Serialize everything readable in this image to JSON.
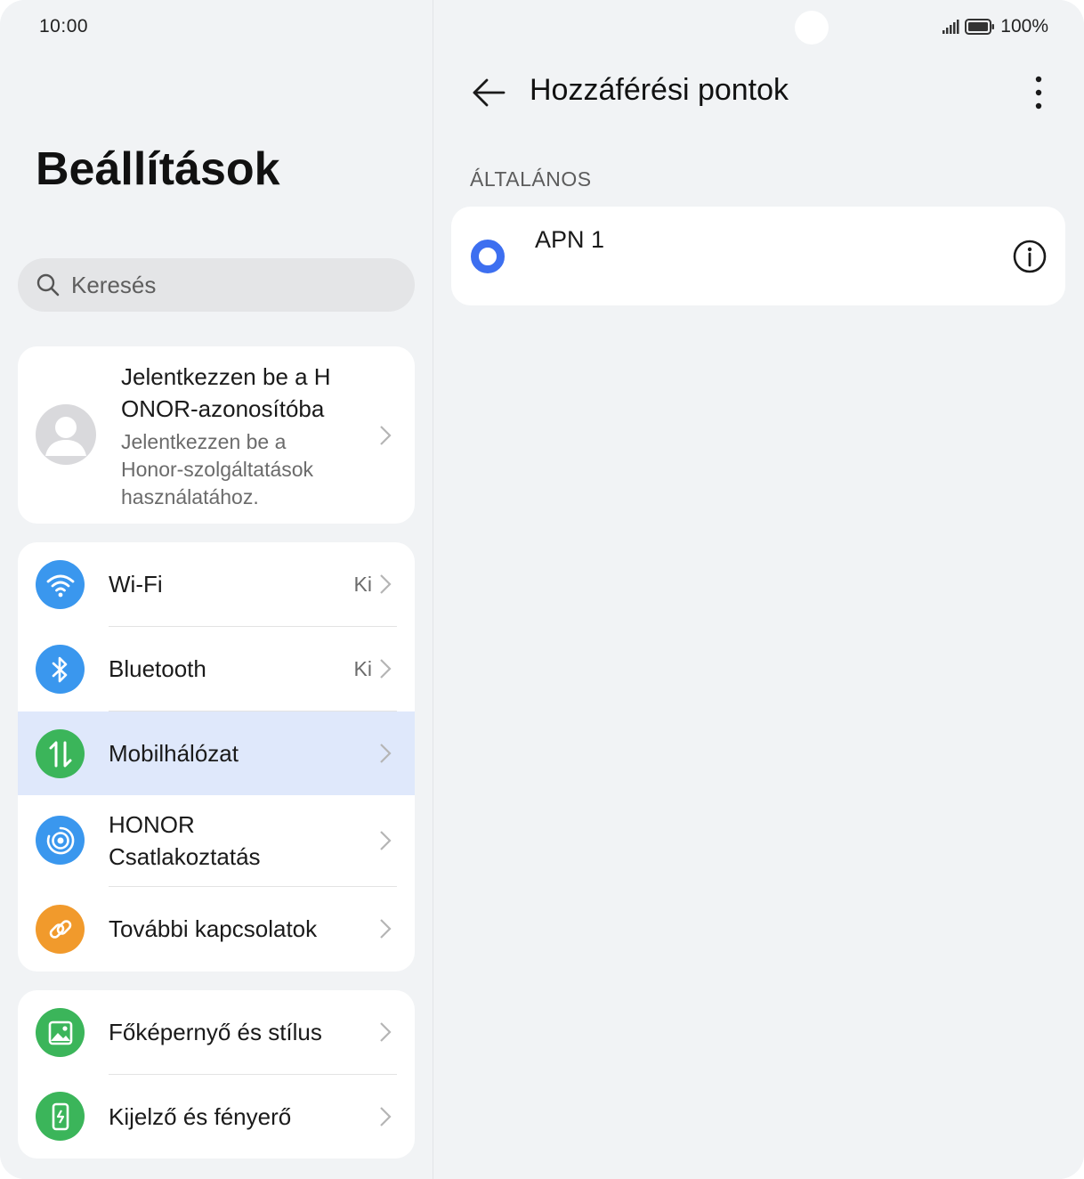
{
  "status_bar": {
    "time": "10:00",
    "battery": "100%",
    "icons": [
      "signal-icon",
      "battery-icon"
    ]
  },
  "settings": {
    "title": "Beállítások",
    "search_placeholder": "Keresés",
    "account": {
      "title": "Jelentkezzen be a HONOR-azonosítóba",
      "title_line1": "Jelentkezzen be a H",
      "title_line2": "ONOR-azonosítóba",
      "subtitle_line1": "Jelentkezzen be a",
      "subtitle_line2": "Honor-szolgáltatások",
      "subtitle_line3": "használatához."
    },
    "network_items": [
      {
        "label": "Wi-Fi",
        "value": "Ki",
        "icon": "wifi-icon",
        "color": "#3a97ee"
      },
      {
        "label": "Bluetooth",
        "value": "Ki",
        "icon": "bluetooth-icon",
        "color": "#3a97ee"
      },
      {
        "label": "Mobilhálózat",
        "value": "",
        "icon": "mobile-data-icon",
        "color": "#3bb55a",
        "selected": true
      },
      {
        "label_line1": "HONOR",
        "label_line2": "Csatlakoztatás",
        "value": "",
        "icon": "honor-connect-icon",
        "color": "#3a97ee"
      },
      {
        "label": "További kapcsolatok",
        "value": "",
        "icon": "link-icon",
        "color": "#f19a2c"
      }
    ],
    "display_items": [
      {
        "label": "Főképernyő és stílus",
        "icon": "wallpaper-icon",
        "color": "#3bb55a"
      },
      {
        "label": "Kijelző és fényerő",
        "icon": "display-brightness-icon",
        "color": "#3bb55a"
      }
    ]
  },
  "apn_screen": {
    "title": "Hozzáférési pontok",
    "section": "ÁLTALÁNOS",
    "apns": [
      {
        "name": "APN 1",
        "selected": true
      }
    ]
  },
  "colors": {
    "accent": "#3d6ff0",
    "highlight_row": "#dfe8fb",
    "background": "#f1f3f5"
  }
}
